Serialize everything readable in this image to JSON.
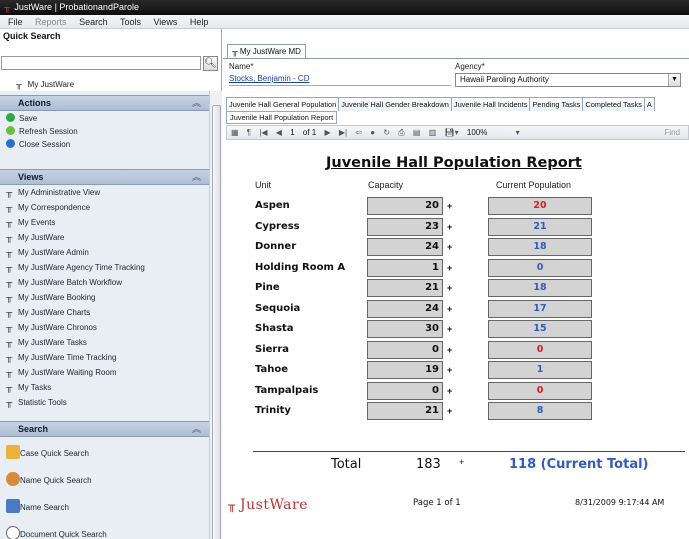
{
  "window": {
    "title": "JustWare | ProbationandParole"
  },
  "menu": [
    "File",
    "Reports",
    "Search",
    "Tools",
    "Views",
    "Help"
  ],
  "sidebar": {
    "quick_search_label": "Quick Search",
    "my_justware": "My JustWare",
    "actions_header": "Actions",
    "actions": [
      "Save",
      "Refresh Session",
      "Close Session"
    ],
    "views_header": "Views",
    "views": [
      "My Administrative View",
      "My Correspondence",
      "My Events",
      "My JustWare",
      "My JustWare Admin",
      "My JustWare Agency Time Tracking",
      "My JustWare Batch Workflow",
      "My JustWare Booking",
      "My JustWare Charts",
      "My JustWare Chronos",
      "My JustWare Tasks",
      "My JustWare Time Tracking",
      "My JustWare Waiting Room",
      "My Tasks",
      "Statistic Tools"
    ],
    "search_header": "Search",
    "search_items": [
      "Case Quick Search",
      "Name Quick Search",
      "Name Search",
      "Document Quick Search"
    ]
  },
  "main": {
    "doc_tab": "My JustWare MD",
    "name_label": "Name*",
    "name_value": "Stocks, Benjamin - CD",
    "agency_label": "Agency*",
    "agency_value": "Hawaii Paroling Authority",
    "report_tabs": [
      "Juvenile Hall General Population",
      "Juvenile Hall Gender Breakdown",
      "Juvenile Hall Incidents",
      "Pending Tasks",
      "Completed Tasks",
      "A"
    ],
    "sub_tab": "Juvenile Hall Population Report",
    "toolbar": {
      "page": "1",
      "of": "of 1",
      "zoom": "100%",
      "find": "Find"
    }
  },
  "report": {
    "title": "Juvenile Hall Population Report",
    "col_unit": "Unit",
    "col_capacity": "Capacity",
    "col_population": "Current Population",
    "rows": [
      {
        "unit": "Aspen",
        "capacity": "20",
        "plus": "+",
        "population": "20",
        "color": "#d62020"
      },
      {
        "unit": "Cypress",
        "capacity": "23",
        "plus": "+",
        "population": "21",
        "color": "#2f5cc0"
      },
      {
        "unit": "Donner",
        "capacity": "24",
        "plus": "+",
        "population": "18",
        "color": "#2f5cc0"
      },
      {
        "unit": "Holding Room A",
        "capacity": "1",
        "plus": "+",
        "population": "0",
        "color": "#2f5cc0"
      },
      {
        "unit": "Pine",
        "capacity": "21",
        "plus": "+",
        "population": "18",
        "color": "#2f5cc0"
      },
      {
        "unit": "Sequoia",
        "capacity": "24",
        "plus": "+",
        "population": "17",
        "color": "#2f5cc0"
      },
      {
        "unit": "Shasta",
        "capacity": "30",
        "plus": "+",
        "population": "15",
        "color": "#2f5cc0"
      },
      {
        "unit": "Sierra",
        "capacity": "0",
        "plus": "+",
        "population": "0",
        "color": "#d62020"
      },
      {
        "unit": "Tahoe",
        "capacity": "19",
        "plus": "+",
        "population": "1",
        "color": "#2f5cc0"
      },
      {
        "unit": "Tampalpais",
        "capacity": "0",
        "plus": "+",
        "population": "0",
        "color": "#d62020"
      },
      {
        "unit": "Trinity",
        "capacity": "21",
        "plus": "+",
        "population": "8",
        "color": "#2f5cc0"
      }
    ],
    "total_label": "Total",
    "total_capacity": "183",
    "total_plus": "+",
    "total_population": "118 (Current Total)",
    "logo": "JustWare",
    "page_footer": "Page 1 of 1",
    "date_footer": "8/31/2009 9:17:44 AM"
  }
}
